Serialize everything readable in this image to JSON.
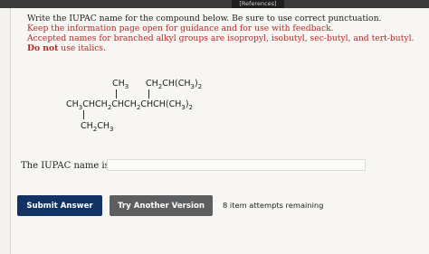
{
  "header": {
    "references_label": "[References]"
  },
  "instructions": {
    "line1": "Write the IUPAC name for the compound below. Be sure to use correct punctuation.",
    "line2": "Keep the information page open for guidance and for use with feedback.",
    "line3": "Accepted names for branched alkyl groups are isopropyl, isobutyl, sec-butyl, and tert-butyl.",
    "line4_bold": "Do not",
    "line4_rest": " use italics."
  },
  "structure": {
    "top_left": "CH3",
    "top_right": "CH2CH(CH3)2",
    "main_chain": "CH3CHCH2CHCH2CHCH(CH3)2",
    "bottom": "CH2CH3"
  },
  "answer": {
    "label": "The IUPAC name is",
    "value": "",
    "placeholder": ""
  },
  "actions": {
    "submit_label": "Submit Answer",
    "try_label": "Try Another Version",
    "attempts_text": "8 item attempts remaining"
  },
  "colors": {
    "instruction_red": "#b42a28",
    "submit_bg": "#123264",
    "try_bg": "#5d5e60"
  }
}
